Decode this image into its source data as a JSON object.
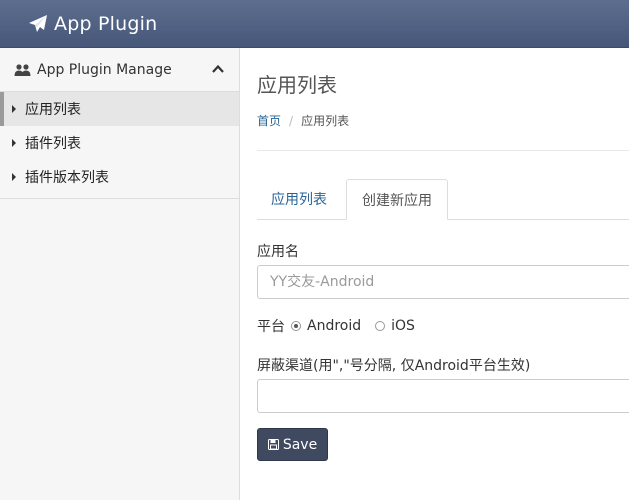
{
  "app": {
    "brand": "App Plugin",
    "brand_icon": "paper-plane-icon"
  },
  "sidebar": {
    "section_title": "App Plugin Manage",
    "section_icon": "users-icon",
    "items": [
      {
        "label": "应用列表",
        "active": true
      },
      {
        "label": "插件列表",
        "active": false
      },
      {
        "label": "插件版本列表",
        "active": false
      }
    ]
  },
  "main": {
    "title": "应用列表",
    "breadcrumb": {
      "home": "首页",
      "current": "应用列表"
    },
    "tabs": [
      {
        "label": "应用列表",
        "active": false
      },
      {
        "label": "创建新应用",
        "active": true
      }
    ],
    "form": {
      "app_name_label": "应用名",
      "app_name_placeholder": "YY交友-Android",
      "platform_label": "平台",
      "platform_options": [
        {
          "label": "Android",
          "checked": true
        },
        {
          "label": "iOS",
          "checked": false
        }
      ],
      "channel_label": "屏蔽渠道(用\",\"号分隔, 仅Android平台生效)",
      "channel_value": "",
      "save_label": "Save"
    }
  },
  "colors": {
    "topbar": "#52627f",
    "link": "#2a6496",
    "button": "#3f4a60"
  }
}
